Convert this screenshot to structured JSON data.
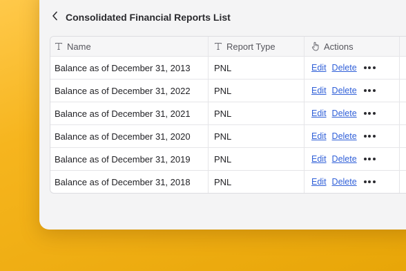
{
  "page": {
    "title": "Consolidated Financial Reports List",
    "back_icon": "chevron-left-icon"
  },
  "table": {
    "columns": [
      {
        "label": "Name",
        "icon": "text-type-icon"
      },
      {
        "label": "Report Type",
        "icon": "text-type-icon"
      },
      {
        "label": "Actions",
        "icon": "hand-pointer-icon"
      }
    ],
    "rows": [
      {
        "name": "Balance as of December 31, 2013",
        "type": "PNL",
        "edit": "Edit",
        "delete": "Delete"
      },
      {
        "name": "Balance as of December 31, 2022",
        "type": "PNL",
        "edit": "Edit",
        "delete": "Delete"
      },
      {
        "name": "Balance as of December 31, 2021",
        "type": "PNL",
        "edit": "Edit",
        "delete": "Delete"
      },
      {
        "name": "Balance as of December 31, 2020",
        "type": "PNL",
        "edit": "Edit",
        "delete": "Delete"
      },
      {
        "name": "Balance as of December 31, 2019",
        "type": "PNL",
        "edit": "Edit",
        "delete": "Delete"
      },
      {
        "name": "Balance as of December 31, 2018",
        "type": "PNL",
        "edit": "Edit",
        "delete": "Delete"
      }
    ]
  },
  "colors": {
    "link": "#2f5fd8",
    "background_gradient_start": "#ffc94a",
    "background_gradient_end": "#e8a608"
  }
}
